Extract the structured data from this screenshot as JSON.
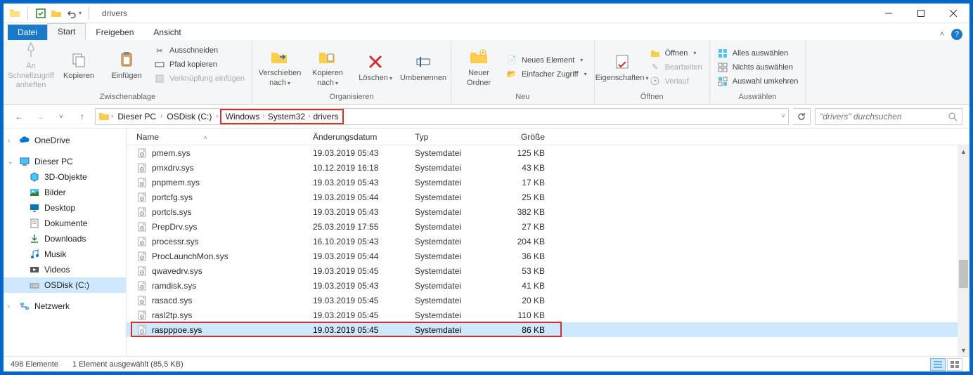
{
  "window": {
    "title": "drivers"
  },
  "tabs": {
    "file": "Datei",
    "start": "Start",
    "share": "Freigeben",
    "view": "Ansicht"
  },
  "ribbon": {
    "clipboard": {
      "label": "Zwischenablage",
      "pin": "An Schnellzugriff anheften",
      "copy": "Kopieren",
      "paste": "Einfügen",
      "cut": "Ausschneiden",
      "copy_path": "Pfad kopieren",
      "paste_shortcut": "Verknüpfung einfügen"
    },
    "organize": {
      "label": "Organisieren",
      "move_to": "Verschieben nach",
      "copy_to": "Kopieren nach",
      "delete": "Löschen",
      "rename": "Umbenennen"
    },
    "new": {
      "label": "Neu",
      "new_folder": "Neuer Ordner",
      "new_item": "Neues Element",
      "easy_access": "Einfacher Zugriff"
    },
    "open": {
      "label": "Öffnen",
      "properties": "Eigenschaften",
      "open": "Öffnen",
      "edit": "Bearbeiten",
      "history": "Verlauf"
    },
    "select": {
      "label": "Auswählen",
      "select_all": "Alles auswählen",
      "select_none": "Nichts auswählen",
      "invert": "Auswahl umkehren"
    }
  },
  "breadcrumb": {
    "this_pc": "Dieser PC",
    "osdisk": "OSDisk (C:)",
    "windows": "Windows",
    "system32": "System32",
    "drivers": "drivers"
  },
  "search": {
    "placeholder": "\"drivers\" durchsuchen"
  },
  "nav": {
    "onedrive": "OneDrive",
    "this_pc": "Dieser PC",
    "objects3d": "3D-Objekte",
    "pictures": "Bilder",
    "desktop": "Desktop",
    "documents": "Dokumente",
    "downloads": "Downloads",
    "music": "Musik",
    "videos": "Videos",
    "osdisk": "OSDisk (C:)",
    "network": "Netzwerk"
  },
  "columns": {
    "name": "Name",
    "date": "Änderungsdatum",
    "type": "Typ",
    "size": "Größe"
  },
  "files": [
    {
      "name": "pmem.sys",
      "date": "19.03.2019 05:43",
      "type": "Systemdatei",
      "size": "125 KB"
    },
    {
      "name": "pmxdrv.sys",
      "date": "10.12.2019 16:18",
      "type": "Systemdatei",
      "size": "43 KB"
    },
    {
      "name": "pnpmem.sys",
      "date": "19.03.2019 05:43",
      "type": "Systemdatei",
      "size": "17 KB"
    },
    {
      "name": "portcfg.sys",
      "date": "19.03.2019 05:44",
      "type": "Systemdatei",
      "size": "25 KB"
    },
    {
      "name": "portcls.sys",
      "date": "19.03.2019 05:43",
      "type": "Systemdatei",
      "size": "382 KB"
    },
    {
      "name": "PrepDrv.sys",
      "date": "25.03.2019 17:55",
      "type": "Systemdatei",
      "size": "27 KB"
    },
    {
      "name": "processr.sys",
      "date": "16.10.2019 05:43",
      "type": "Systemdatei",
      "size": "204 KB"
    },
    {
      "name": "ProcLaunchMon.sys",
      "date": "19.03.2019 05:44",
      "type": "Systemdatei",
      "size": "36 KB"
    },
    {
      "name": "qwavedrv.sys",
      "date": "19.03.2019 05:45",
      "type": "Systemdatei",
      "size": "53 KB"
    },
    {
      "name": "ramdisk.sys",
      "date": "19.03.2019 05:43",
      "type": "Systemdatei",
      "size": "41 KB"
    },
    {
      "name": "rasacd.sys",
      "date": "19.03.2019 05:45",
      "type": "Systemdatei",
      "size": "20 KB"
    },
    {
      "name": "rasl2tp.sys",
      "date": "19.03.2019 05:45",
      "type": "Systemdatei",
      "size": "110 KB"
    },
    {
      "name": "raspppoe.sys",
      "date": "19.03.2019 05:45",
      "type": "Systemdatei",
      "size": "86 KB"
    }
  ],
  "status": {
    "count": "498 Elemente",
    "selection": "1 Element ausgewählt (85,5 KB)"
  }
}
